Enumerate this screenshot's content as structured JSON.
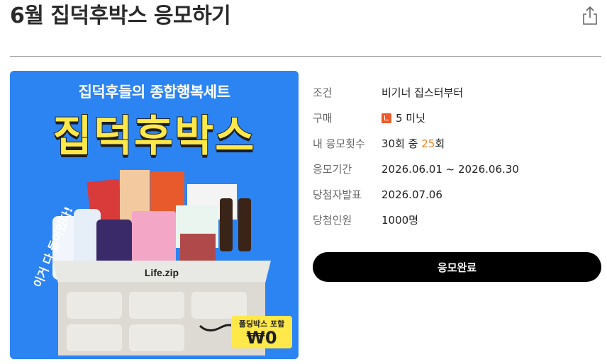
{
  "page": {
    "title": "6월 집덕후박스 응모하기"
  },
  "banner": {
    "subtitle": "집덕후들의 종합행복세트",
    "headline": "집덕후박스",
    "side_text": "이거 다 들어있다!",
    "box_brand": "Life.zip",
    "badge_top": "폴딩박스 포함",
    "badge_price": "₩0",
    "colors": {
      "background": "#2c84f3",
      "headline": "#ffe84a",
      "badge": "#ffe84a"
    }
  },
  "details": [
    {
      "key": "조건",
      "value": "비기너 집스터부터"
    },
    {
      "key": "구매",
      "value": "5 미닛",
      "icon": "minute-coin-icon"
    },
    {
      "key": "내 응모횟수",
      "value_pre": "30회 중 ",
      "value_highlight": "25",
      "value_post": "회"
    },
    {
      "key": "응모기간",
      "value": "2026.06.01 ~ 2026.06.30"
    },
    {
      "key": "당첨자발표",
      "value": "2026.07.06"
    },
    {
      "key": "당첨인원",
      "value": "1000명"
    }
  ],
  "cta": {
    "label": "응모완료"
  },
  "colors": {
    "highlight": "#f08427",
    "cta_bg": "#000000"
  },
  "icons": {
    "share": "share-icon"
  }
}
